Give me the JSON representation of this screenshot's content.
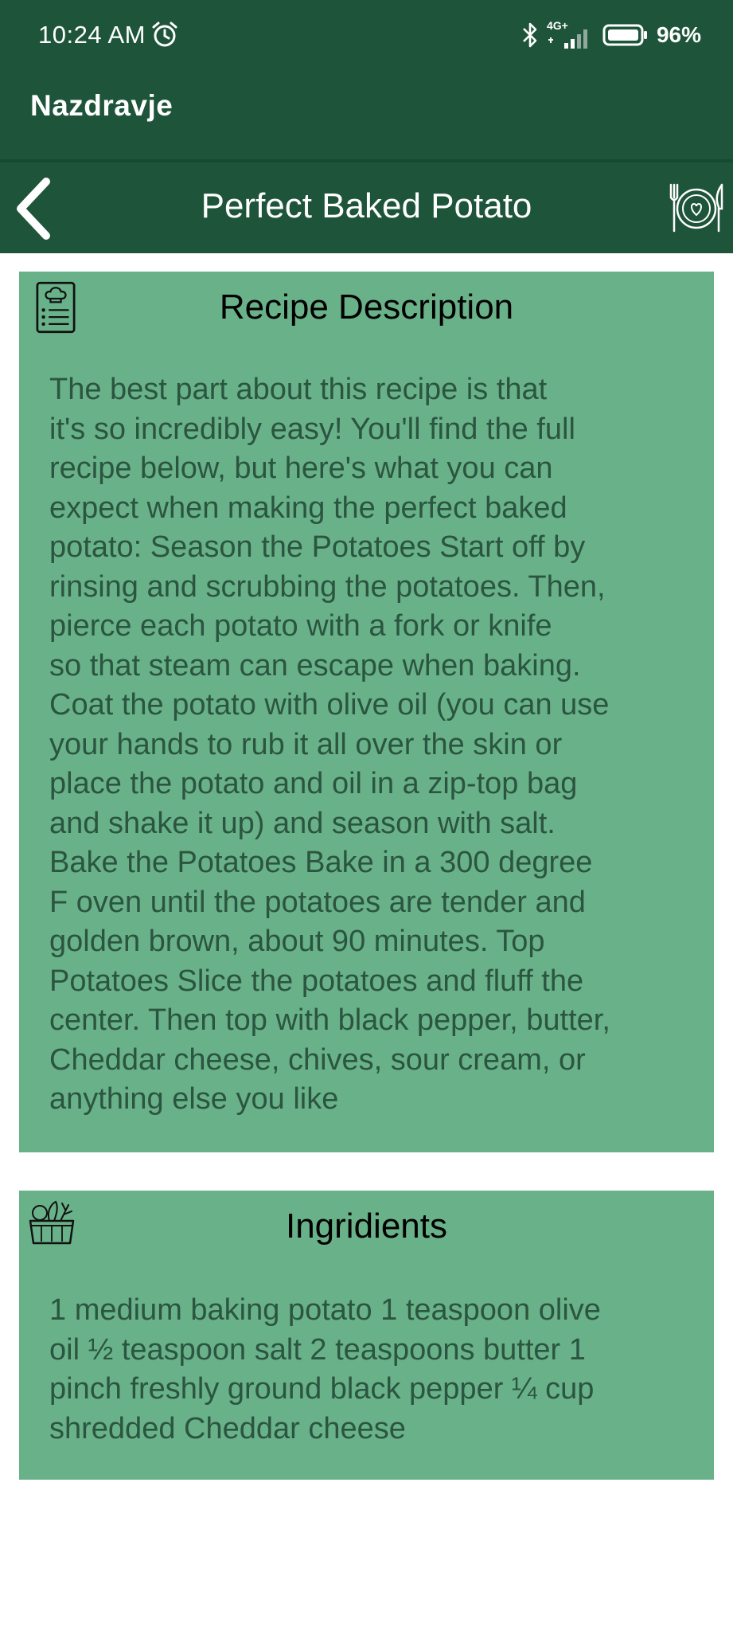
{
  "status_bar": {
    "time": "10:24 AM",
    "network": "4G+",
    "battery": "96%"
  },
  "app": {
    "title": "Nazdravje"
  },
  "toolbar": {
    "title": "Perfect Baked Potato"
  },
  "description": {
    "title": "Recipe Description",
    "text": "The best part about this recipe is that\nit's so incredibly easy! You'll find the full\nrecipe below, but here's what you can\nexpect when making the perfect baked\npotato:  Season the Potatoes Start off by\nrinsing and scrubbing the potatoes. Then,\npierce each potato with a fork or knife\nso that steam can escape when baking.\nCoat the potato with olive oil (you can use\nyour hands to rub it all over the skin or\nplace the potato and oil in a zip-top bag\nand shake it up) and season with salt.\nBake the Potatoes Bake in a 300 degree\nF oven until the potatoes are tender and\ngolden brown, about 90 minutes.  Top\nPotatoes Slice the potatoes and fluff the\ncenter. Then top with black pepper, butter,\nCheddar cheese, chives, sour cream, or\nanything else you like"
  },
  "ingredients": {
    "title": "Ingridients",
    "text": "1 medium baking potato  1 teaspoon olive\noil  ½ teaspoon salt  2 teaspoons butter  1\npinch freshly ground black pepper  ¼ cup\nshredded Cheddar cheese"
  },
  "colors": {
    "header": "#1e553a",
    "card": "#69b289",
    "body_text": "#2b5540"
  },
  "icons": {
    "alarm": "alarm-icon",
    "bluetooth": "bluetooth-icon",
    "signal": "signal-icon",
    "battery": "battery-icon",
    "back": "back-arrow-icon",
    "toolbar_action": "plate-cutlery-icon",
    "description": "recipe-card-icon",
    "ingredients": "food-basket-icon"
  }
}
